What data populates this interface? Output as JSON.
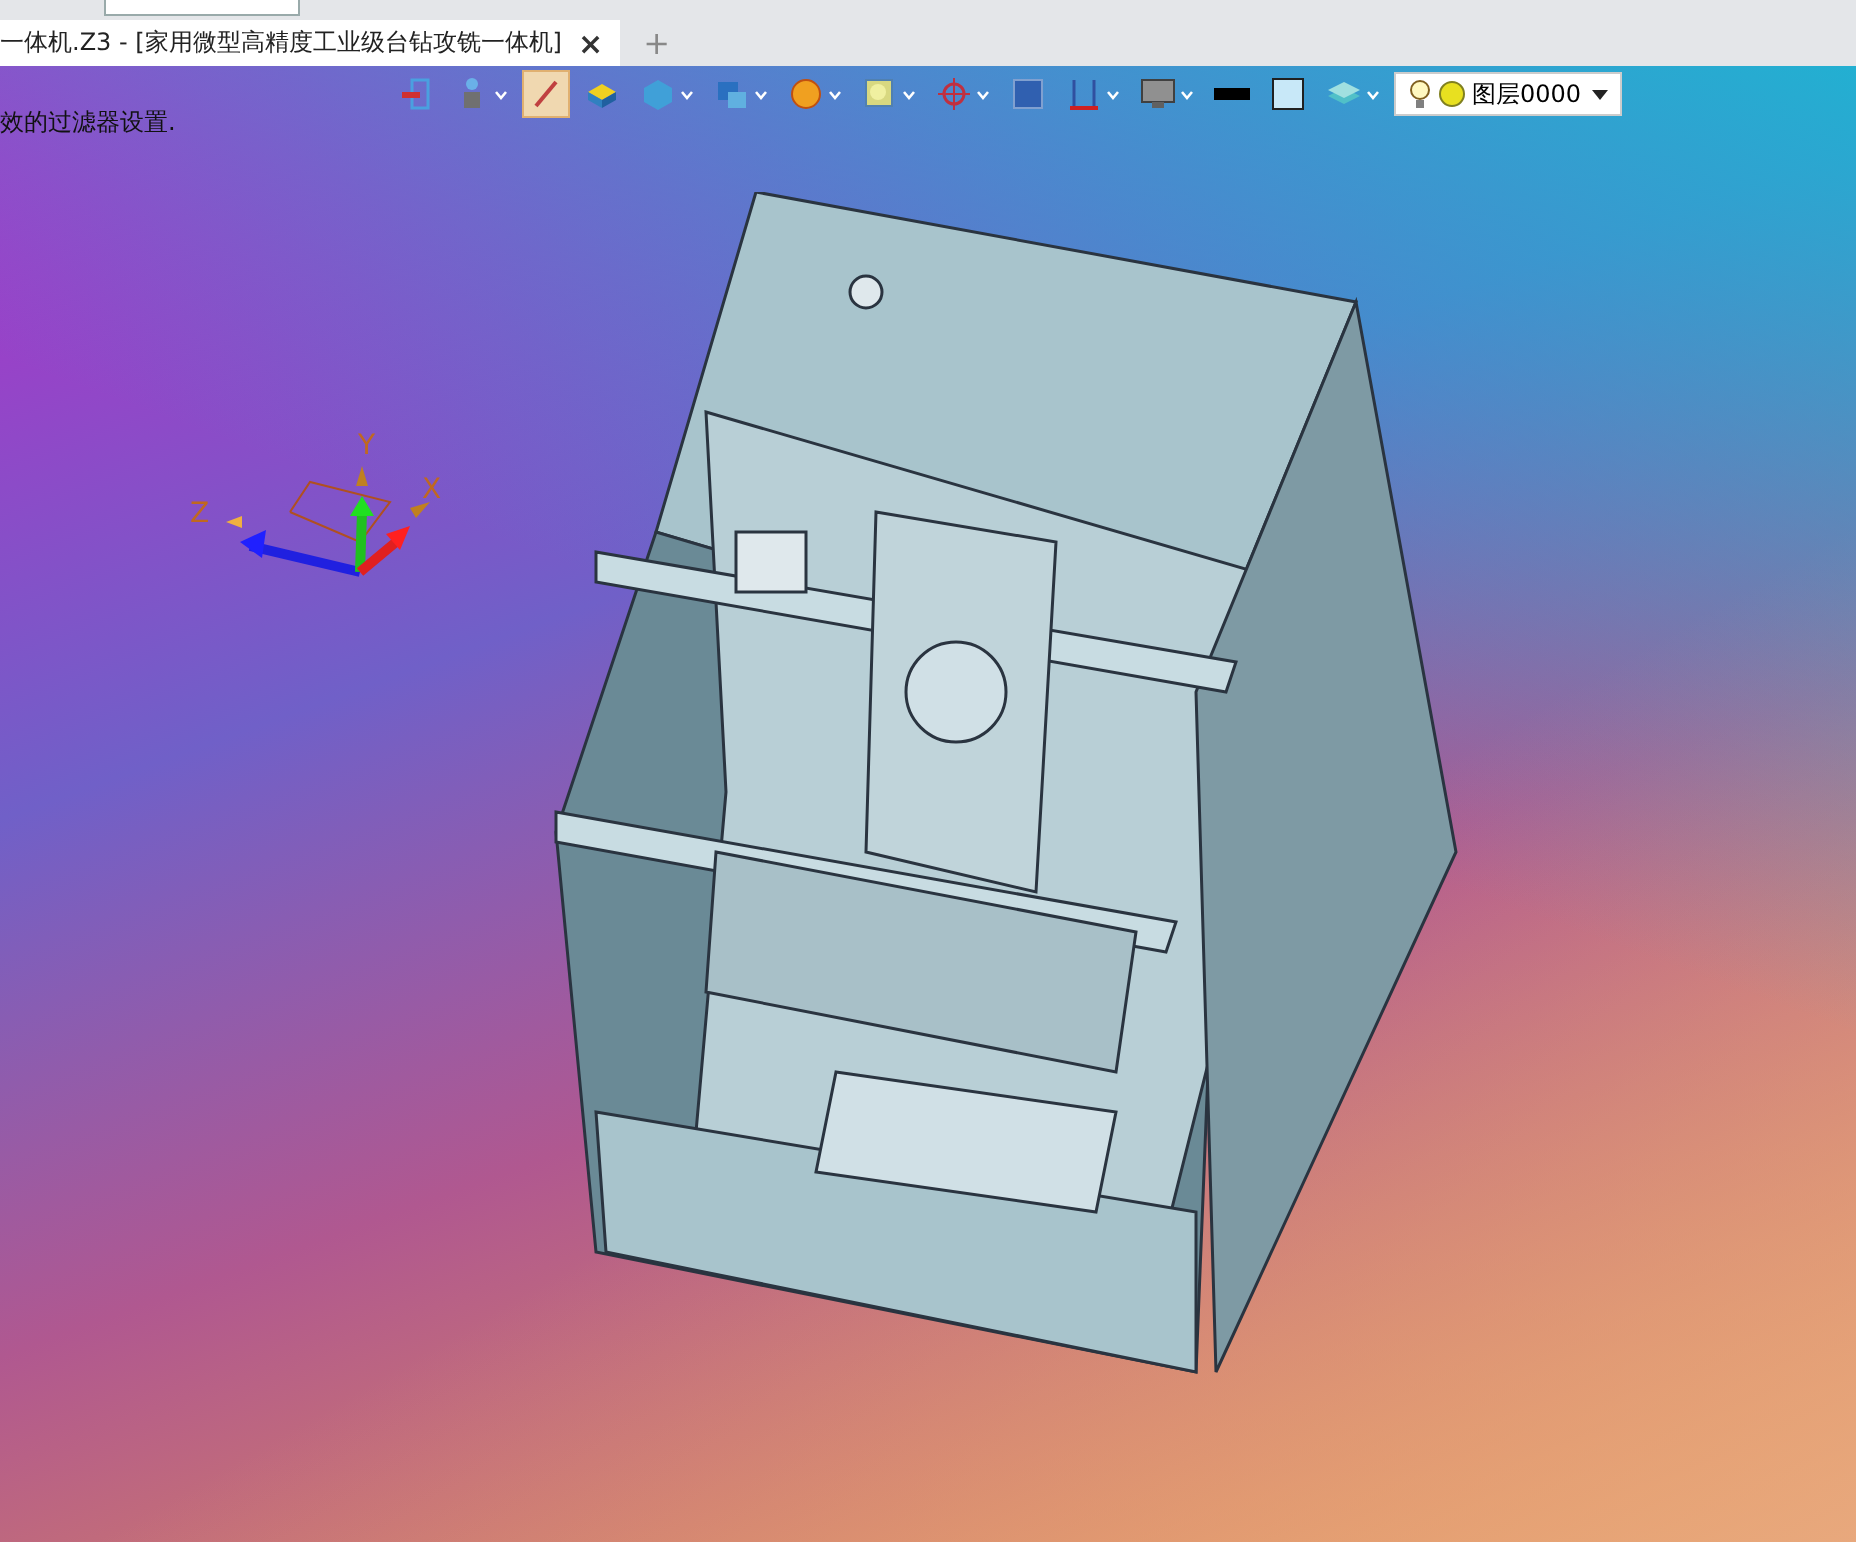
{
  "tab": {
    "title": "一体机.Z3 - [家用微型高精度工业级台钻攻铣一体机]",
    "close": "×",
    "add": "+"
  },
  "hint": "效的过滤器设置.",
  "toolbar": [
    {
      "kind": "exit",
      "menu": false,
      "selected": false
    },
    {
      "kind": "person",
      "menu": true,
      "selected": false
    },
    {
      "kind": "brush",
      "menu": false,
      "selected": true
    },
    {
      "kind": "box",
      "menu": false,
      "selected": false
    },
    {
      "kind": "cube",
      "menu": true,
      "selected": false
    },
    {
      "kind": "views",
      "menu": true,
      "selected": false
    },
    {
      "kind": "wheel",
      "menu": true,
      "selected": false
    },
    {
      "kind": "zoom",
      "menu": true,
      "selected": false
    },
    {
      "kind": "target",
      "menu": true,
      "selected": false
    },
    {
      "kind": "frame",
      "menu": false,
      "selected": false
    },
    {
      "kind": "ruler",
      "menu": true,
      "selected": false
    },
    {
      "kind": "monitor",
      "menu": true,
      "selected": false
    },
    {
      "kind": "line",
      "menu": false,
      "selected": false
    },
    {
      "kind": "swatch",
      "menu": false,
      "selected": false
    },
    {
      "kind": "layers",
      "menu": true,
      "selected": false
    }
  ],
  "layer": {
    "label": "图层0000"
  },
  "axes": {
    "x": "X",
    "y": "Y",
    "z": "Z"
  }
}
